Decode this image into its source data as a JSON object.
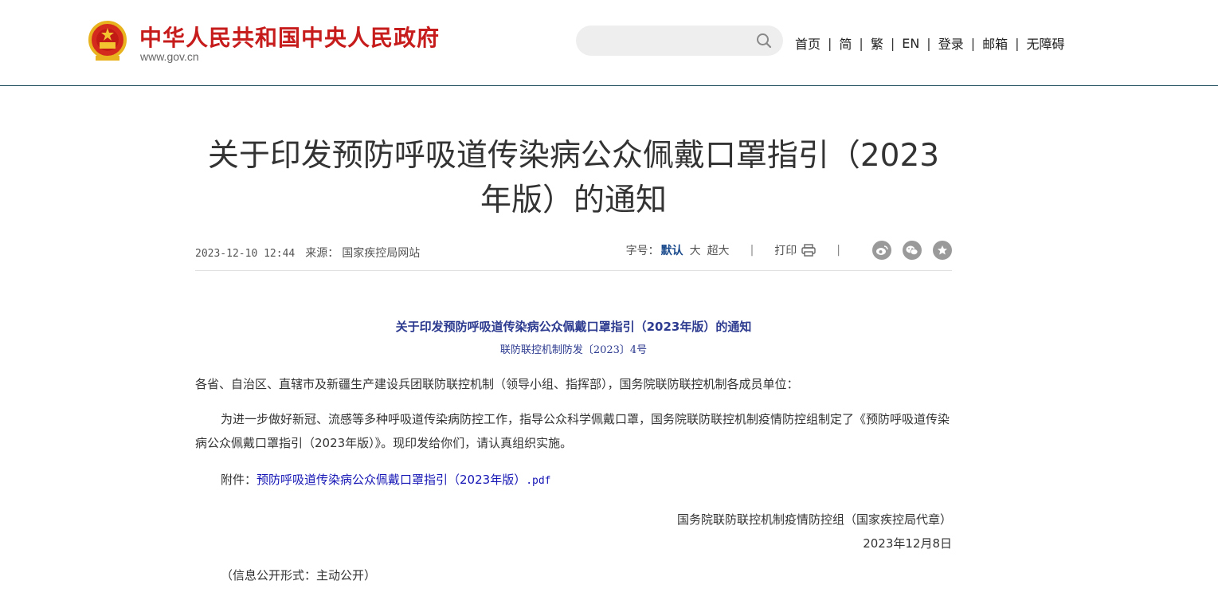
{
  "header": {
    "site_title": "中华人民共和国中央人民政府",
    "site_url": "www.gov.cn",
    "search_placeholder": "",
    "nav": [
      "首页",
      "简",
      "繁",
      "EN",
      "登录",
      "邮箱",
      "无障碍"
    ],
    "nav_sep": "|"
  },
  "article": {
    "title": "关于印发预防呼吸道传染病公众佩戴口罩指引（2023年版）的通知",
    "datetime": "2023-12-10 12:44",
    "source_label": "来源：",
    "source": "国家疾控局网站",
    "font_size_label": "字号：",
    "font_size_default": "默认",
    "font_size_large": "大",
    "font_size_xlarge": "超大",
    "tools_sep": "|",
    "print_label": "打印",
    "share_icons": [
      "weibo-icon",
      "wechat-icon",
      "favorite-icon"
    ]
  },
  "content": {
    "sub_title": "关于印发预防呼吸道传染病公众佩戴口罩指引（2023年版）的通知",
    "doc_number": "联防联控机制防发〔2023〕4号",
    "recipients": "各省、自治区、直辖市及新疆生产建设兵团联防联控机制（领导小组、指挥部），国务院联防联控机制各成员单位：",
    "main_paragraph": "为进一步做好新冠、流感等多种呼吸道传染病防控工作，指导公众科学佩戴口罩，国务院联防联控机制疫情防控组制定了《预防呼吸道传染病公众佩戴口罩指引（2023年版）》。现印发给你们，请认真组织实施。",
    "attachment_label": "附件：",
    "attachment_link": "预防呼吸道传染病公众佩戴口罩指引（2023年版）",
    "attachment_ext": ".pdf",
    "signature": "国务院联防联控机制疫情防控组（国家疾控局代章）",
    "date": "2023年12月8日",
    "disclosure": "（信息公开形式：主动公开）"
  },
  "colors": {
    "brand_red": "#c71c1c",
    "link_blue": "#1515b5",
    "subtitle_blue": "#2c3a8f",
    "header_border": "#1f4e5f"
  }
}
